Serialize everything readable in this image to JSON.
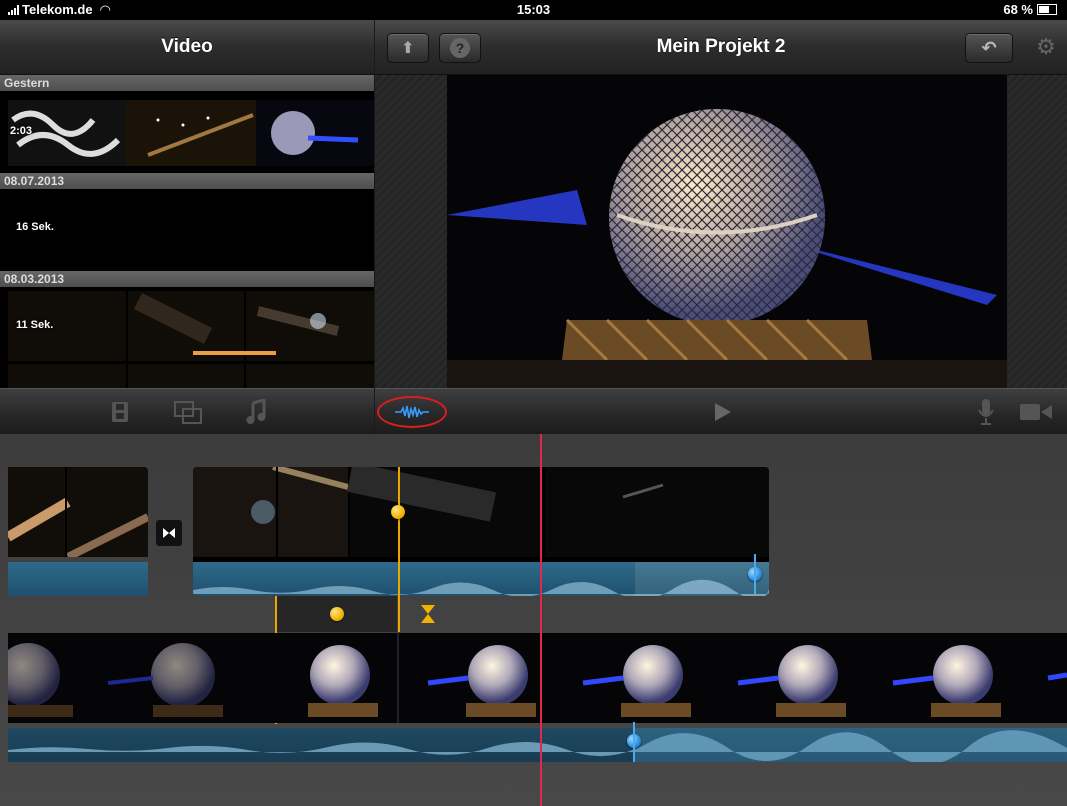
{
  "status_bar": {
    "carrier": "Telekom.de",
    "time": "15:03",
    "battery": "68 %"
  },
  "browser": {
    "title": "Video",
    "sections": [
      {
        "date": "Gestern",
        "duration": "2:03"
      },
      {
        "date": "08.07.2013",
        "duration": "16 Sek."
      },
      {
        "date": "08.03.2013",
        "duration": "11 Sek."
      }
    ],
    "tabs": [
      "video-tab",
      "photos-tab",
      "audio-tab"
    ]
  },
  "viewer": {
    "title": "Mein Projekt 2",
    "help_label": "?"
  },
  "toolbar": {
    "waveform_highlighted": true,
    "icons": [
      "waveform-icon",
      "play-icon",
      "microphone-icon",
      "camera-icon"
    ]
  },
  "colors": {
    "accent_yellow": "#f0b400",
    "audio_blue": "#2f6a8a",
    "playhead_red": "#e0284a",
    "highlight_circle": "#d81e1e"
  }
}
